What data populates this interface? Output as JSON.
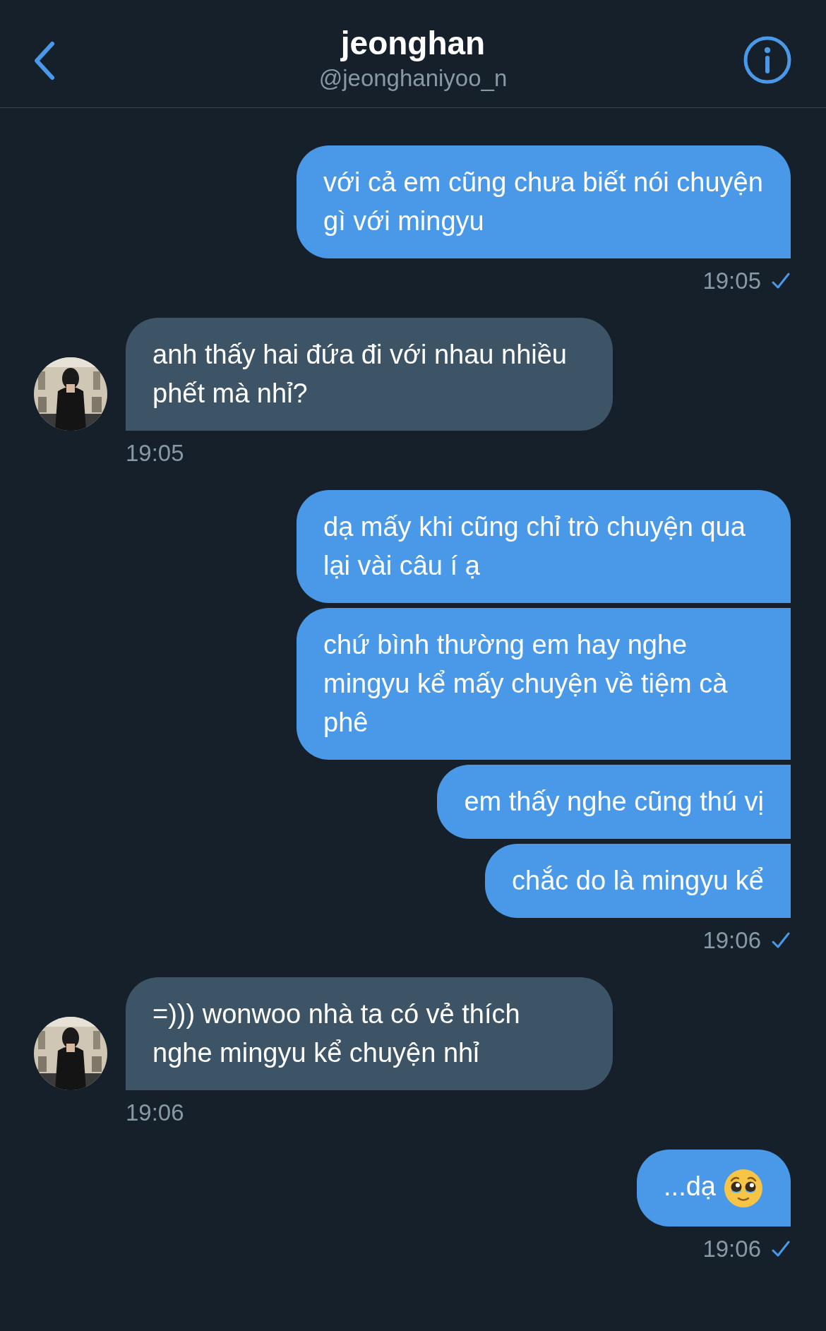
{
  "header": {
    "name": "jeonghan",
    "handle": "@jeonghaniyoo_n"
  },
  "groups": [
    {
      "kind": "sent",
      "bubbles": [
        {
          "text": "với cả em cũng chưa biết nói chuyện gì với mingyu"
        }
      ],
      "time": "19:05",
      "read": true
    },
    {
      "kind": "received",
      "bubbles": [
        {
          "text": "anh thấy hai đứa đi với nhau nhiều phết mà nhỉ?"
        }
      ],
      "time": "19:05"
    },
    {
      "kind": "sent",
      "bubbles": [
        {
          "text": "dạ mấy khi cũng chỉ trò chuyện qua lại vài câu í ạ"
        },
        {
          "text": "chứ bình thường em hay nghe mingyu kể mấy chuyện về tiệm cà phê"
        },
        {
          "text": "em thấy nghe cũng thú vị"
        },
        {
          "text": "chắc do là mingyu kể"
        }
      ],
      "time": "19:06",
      "read": true
    },
    {
      "kind": "received",
      "bubbles": [
        {
          "text": "=))) wonwoo nhà ta có vẻ thích nghe mingyu kể chuyện nhỉ"
        }
      ],
      "time": "19:06"
    },
    {
      "kind": "sent",
      "bubbles": [
        {
          "text": "...dạ",
          "emoji": true
        }
      ],
      "time": "19:06",
      "read": true
    }
  ]
}
